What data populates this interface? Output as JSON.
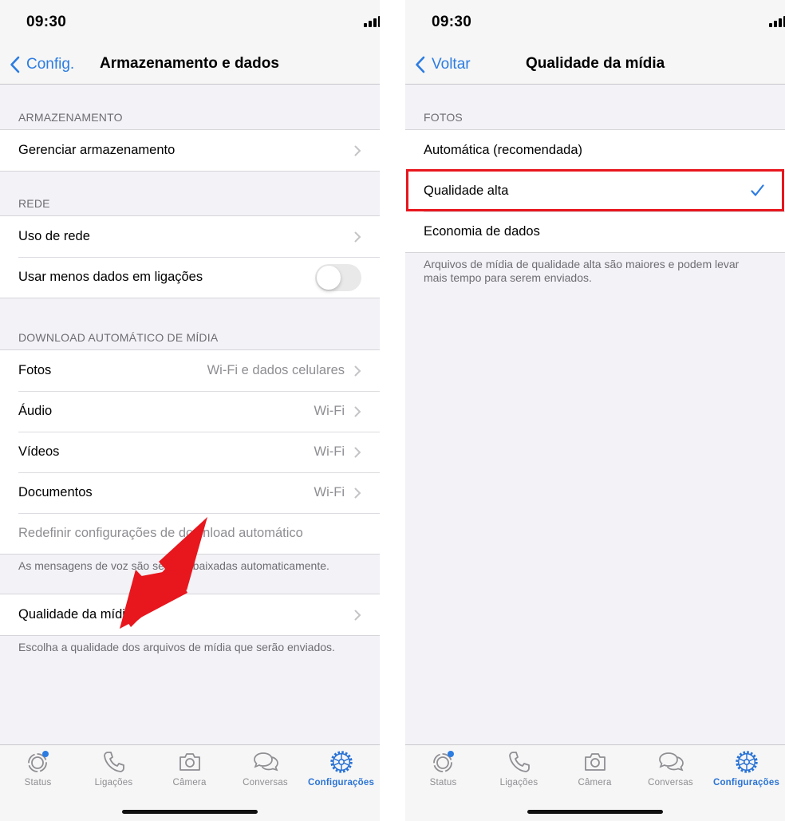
{
  "colors": {
    "accent": "#2c7ce2",
    "tab_active": "#2a73d5",
    "highlight_red": "#e8161d",
    "annotation_arrow": "#e8161d",
    "status_dot": "#2c7ce2",
    "background": "#f2f2f7"
  },
  "left": {
    "status": {
      "time": "09:30"
    },
    "nav": {
      "back_label": "Config.",
      "title": "Armazenamento e dados"
    },
    "storage": {
      "header": "ARMAZENAMENTO",
      "items": [
        {
          "label": "Gerenciar armazenamento",
          "icon": "chevron-right-icon"
        }
      ]
    },
    "network": {
      "header": "REDE",
      "items": [
        {
          "label": "Uso de rede",
          "icon": "chevron-right-icon"
        },
        {
          "label": "Usar menos dados em ligações",
          "toggle": false
        }
      ]
    },
    "auto_download": {
      "header": "DOWNLOAD AUTOMÁTICO DE MÍDIA",
      "items": [
        {
          "label": "Fotos",
          "value": "Wi-Fi e dados celulares"
        },
        {
          "label": "Áudio",
          "value": "Wi-Fi"
        },
        {
          "label": "Vídeos",
          "value": "Wi-Fi"
        },
        {
          "label": "Documentos",
          "value": "Wi-Fi"
        },
        {
          "label": "Redefinir configurações de download automático"
        }
      ],
      "footer": "As mensagens de voz são sempre baixadas automaticamente."
    },
    "media_quality": {
      "label": "Qualidade da mídia",
      "footer": "Escolha a qualidade dos arquivos de mídia que serão enviados."
    }
  },
  "right": {
    "status": {
      "time": "09:30"
    },
    "nav": {
      "back_label": "Voltar",
      "title": "Qualidade da mídia"
    },
    "photos": {
      "header": "FOTOS",
      "options": [
        {
          "label": "Automática (recomendada)",
          "selected": false
        },
        {
          "label": "Qualidade alta",
          "selected": true
        },
        {
          "label": "Economia de dados",
          "selected": false
        }
      ],
      "footer_line1": "Arquivos de mídia de qualidade alta são maiores e podem levar",
      "footer_line2": "mais tempo para serem enviados."
    }
  },
  "tabbar": {
    "tabs": [
      {
        "label": "Status",
        "icon": "status-icon",
        "active": false
      },
      {
        "label": "Ligações",
        "icon": "phone-icon",
        "active": false
      },
      {
        "label": "Câmera",
        "icon": "camera-icon",
        "active": false
      },
      {
        "label": "Conversas",
        "icon": "chat-bubbles-icon",
        "active": false
      },
      {
        "label": "Configurações",
        "icon": "gear-icon",
        "active": true
      }
    ]
  }
}
